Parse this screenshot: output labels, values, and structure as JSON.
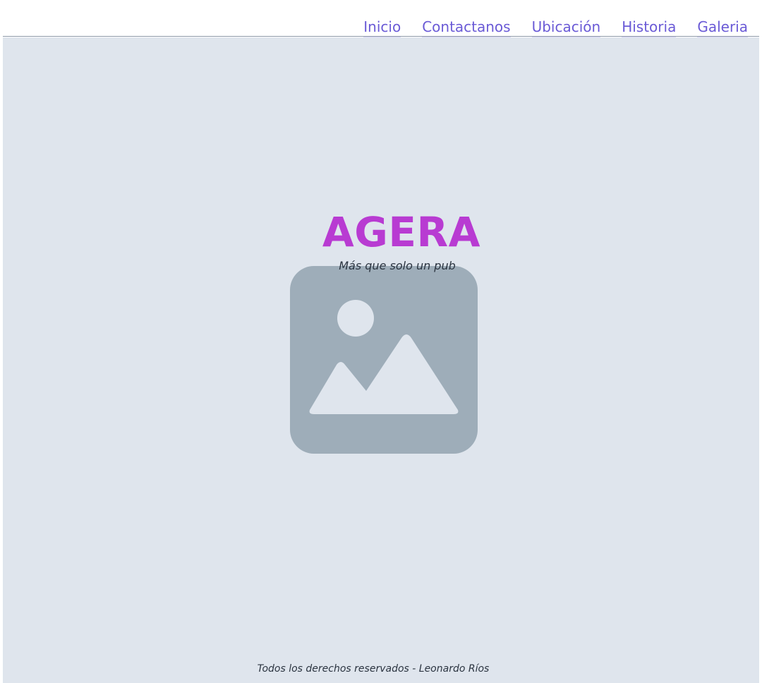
{
  "nav": {
    "items": [
      {
        "label": "Inicio"
      },
      {
        "label": "Contactanos"
      },
      {
        "label": "Ubicación"
      },
      {
        "label": "Historia"
      },
      {
        "label": "Galeria"
      }
    ]
  },
  "hero": {
    "title": "AGERA",
    "subtitle": "Más que solo un pub",
    "image_icon": "image-placeholder-icon"
  },
  "footer": {
    "text": "Todos los derechos reservados - Leonardo Ríos"
  },
  "colors": {
    "nav_link": "#6a5ad6",
    "title": "#b83bd2",
    "background": "#dfe5ed",
    "placeholder": "#9eadb9"
  }
}
